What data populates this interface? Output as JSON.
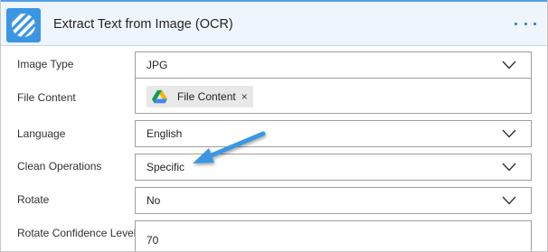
{
  "action": {
    "title": "Extract Text from Image (OCR)",
    "logo_icon": "stripes-logo-icon",
    "menu_icon": "ellipsis-icon"
  },
  "fields": {
    "image_type": {
      "label": "Image Type",
      "value": "JPG"
    },
    "file_content": {
      "label": "File Content",
      "token_label": "File Content",
      "token_icon": "google-drive-icon",
      "remove_symbol": "×"
    },
    "language": {
      "label": "Language",
      "value": "English"
    },
    "clean_operations": {
      "label": "Clean Operations",
      "value": "Specific"
    },
    "rotate": {
      "label": "Rotate",
      "value": "No"
    },
    "rotate_confidence_level": {
      "label": "Rotate Confidence Level",
      "value": "70"
    }
  },
  "annotation": {
    "icon": "arrow-pointer-icon",
    "color": "#3a96e3"
  },
  "colors": {
    "accent": "#3a96e3",
    "header_bg": "#eef5fc",
    "border": "#a19f9d"
  }
}
